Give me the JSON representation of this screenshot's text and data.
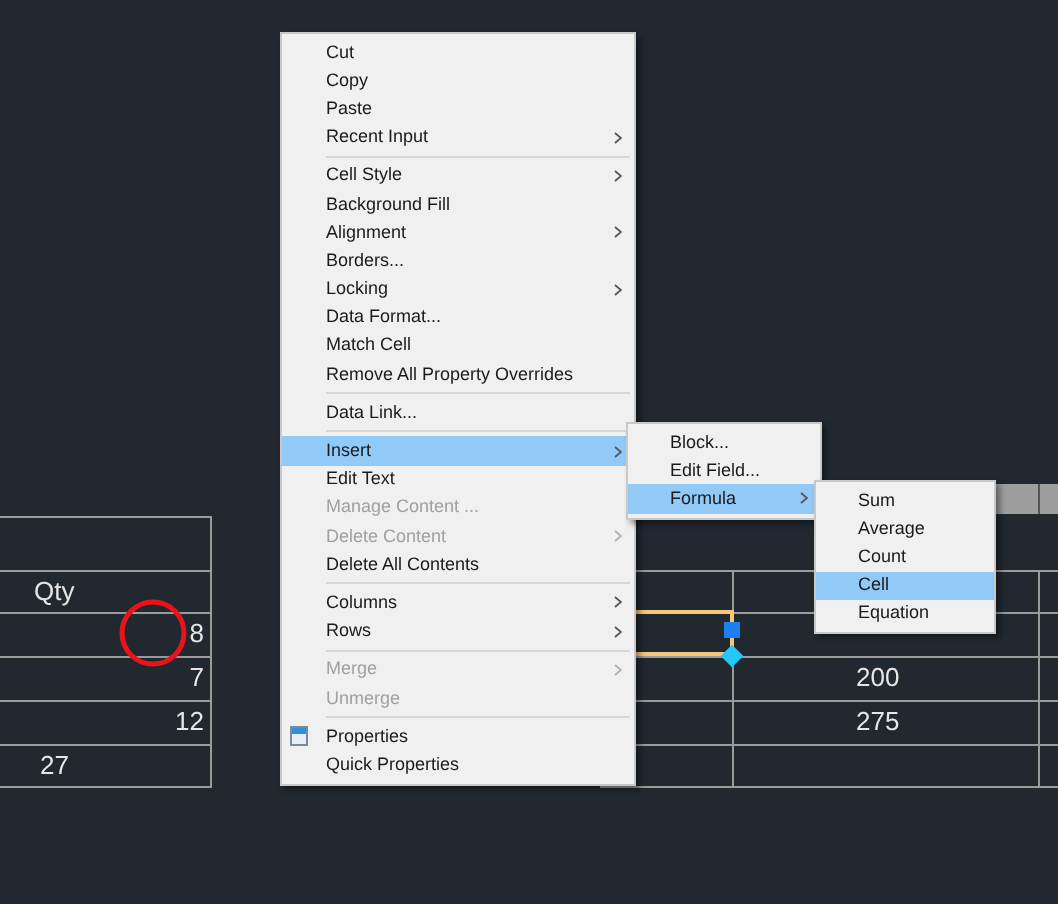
{
  "left_table": {
    "rows": [
      {
        "kind": "header",
        "text": "Qty"
      },
      {
        "kind": "value",
        "text": "8"
      },
      {
        "kind": "value",
        "text": "7"
      },
      {
        "kind": "value",
        "text": "12"
      },
      {
        "kind": "total",
        "text": "27"
      }
    ]
  },
  "right_table": {
    "rows": [
      "200",
      "275"
    ]
  },
  "context_menu": {
    "items": [
      {
        "kind": "item",
        "label": "Cut",
        "submenu": false,
        "disabled": false,
        "selected": false
      },
      {
        "kind": "item",
        "label": "Copy",
        "submenu": false,
        "disabled": false,
        "selected": false
      },
      {
        "kind": "item",
        "label": "Paste",
        "submenu": false,
        "disabled": false,
        "selected": false
      },
      {
        "kind": "item",
        "label": "Recent Input",
        "submenu": true,
        "disabled": false,
        "selected": false
      },
      {
        "kind": "separator"
      },
      {
        "kind": "item",
        "label": "Cell Style",
        "submenu": true,
        "disabled": false,
        "selected": false
      },
      {
        "kind": "item",
        "label": "Background Fill",
        "submenu": false,
        "disabled": false,
        "selected": false
      },
      {
        "kind": "item",
        "label": "Alignment",
        "submenu": true,
        "disabled": false,
        "selected": false
      },
      {
        "kind": "item",
        "label": "Borders...",
        "submenu": false,
        "disabled": false,
        "selected": false
      },
      {
        "kind": "item",
        "label": "Locking",
        "submenu": true,
        "disabled": false,
        "selected": false
      },
      {
        "kind": "item",
        "label": "Data Format...",
        "submenu": false,
        "disabled": false,
        "selected": false
      },
      {
        "kind": "item",
        "label": "Match Cell",
        "submenu": false,
        "disabled": false,
        "selected": false
      },
      {
        "kind": "item",
        "label": "Remove All Property Overrides",
        "submenu": false,
        "disabled": false,
        "selected": false
      },
      {
        "kind": "separator"
      },
      {
        "kind": "item",
        "label": "Data Link...",
        "submenu": false,
        "disabled": false,
        "selected": false
      },
      {
        "kind": "separator"
      },
      {
        "kind": "item",
        "label": "Insert",
        "submenu": true,
        "disabled": false,
        "selected": true
      },
      {
        "kind": "item",
        "label": "Edit Text",
        "submenu": false,
        "disabled": false,
        "selected": false
      },
      {
        "kind": "item",
        "label": "Manage Content ...",
        "submenu": false,
        "disabled": true,
        "selected": false
      },
      {
        "kind": "item",
        "label": "Delete Content",
        "submenu": true,
        "disabled": true,
        "selected": false
      },
      {
        "kind": "item",
        "label": "Delete All Contents",
        "submenu": false,
        "disabled": false,
        "selected": false
      },
      {
        "kind": "separator"
      },
      {
        "kind": "item",
        "label": "Columns",
        "submenu": true,
        "disabled": false,
        "selected": false
      },
      {
        "kind": "item",
        "label": "Rows",
        "submenu": true,
        "disabled": false,
        "selected": false
      },
      {
        "kind": "separator"
      },
      {
        "kind": "item",
        "label": "Merge",
        "submenu": true,
        "disabled": true,
        "selected": false
      },
      {
        "kind": "item",
        "label": "Unmerge",
        "submenu": false,
        "disabled": true,
        "selected": false
      },
      {
        "kind": "separator"
      },
      {
        "kind": "icon_item",
        "label": "Properties",
        "submenu": false,
        "disabled": false,
        "selected": false
      },
      {
        "kind": "item",
        "label": "Quick Properties",
        "submenu": false,
        "disabled": false,
        "selected": false
      }
    ]
  },
  "insert_submenu": {
    "items": [
      {
        "kind": "item",
        "label": "Block...",
        "submenu": false,
        "disabled": false,
        "selected": false
      },
      {
        "kind": "item",
        "label": "Edit Field...",
        "submenu": false,
        "disabled": false,
        "selected": false
      },
      {
        "kind": "item",
        "label": "Formula",
        "submenu": true,
        "disabled": false,
        "selected": true
      }
    ]
  },
  "formula_submenu": {
    "items": [
      {
        "kind": "item",
        "label": "Sum",
        "submenu": false,
        "disabled": false,
        "selected": false
      },
      {
        "kind": "item",
        "label": "Average",
        "submenu": false,
        "disabled": false,
        "selected": false
      },
      {
        "kind": "item",
        "label": "Count",
        "submenu": false,
        "disabled": false,
        "selected": false
      },
      {
        "kind": "item",
        "label": "Cell",
        "submenu": false,
        "disabled": false,
        "selected": true
      },
      {
        "kind": "item",
        "label": "Equation",
        "submenu": false,
        "disabled": false,
        "selected": false
      }
    ]
  }
}
